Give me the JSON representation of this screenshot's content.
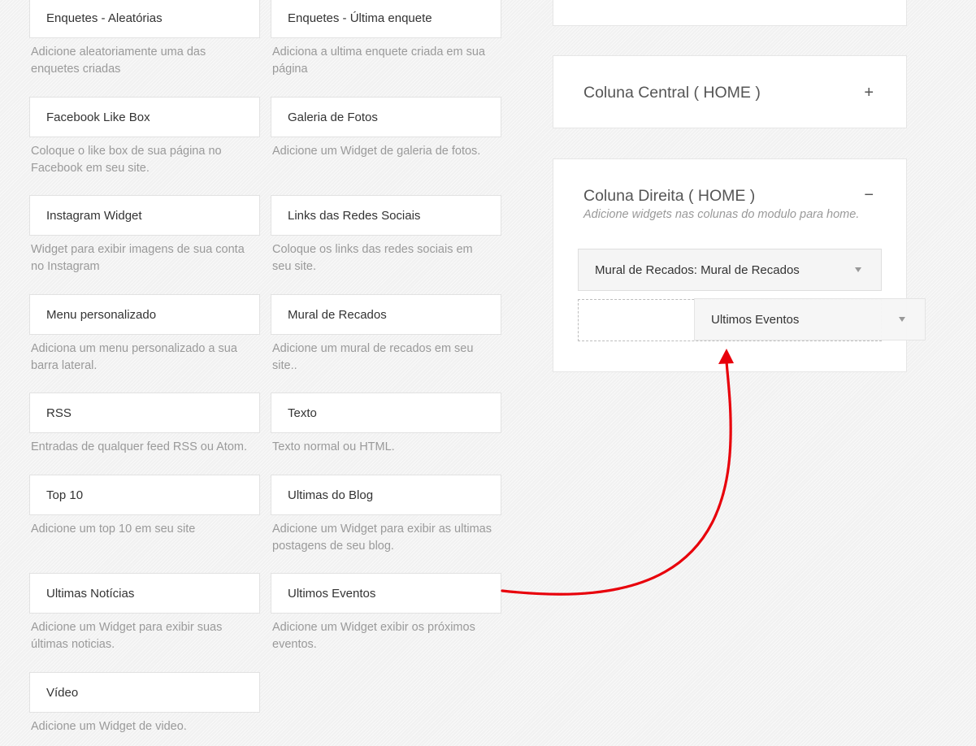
{
  "widgets": [
    {
      "title": "Enquetes - Aleatórias",
      "desc": "Adicione aleatoriamente uma das enquetes criadas"
    },
    {
      "title": "Enquetes - Última enquete",
      "desc": "Adiciona a ultima enquete criada em sua página"
    },
    {
      "title": "Facebook Like Box",
      "desc": "Coloque o like box de sua página no Facebook em seu site."
    },
    {
      "title": "Galeria de Fotos",
      "desc": "Adicione um Widget de galeria de fotos."
    },
    {
      "title": "Instagram Widget",
      "desc": "Widget para exibir imagens de sua conta no Instagram"
    },
    {
      "title": "Links das Redes Sociais",
      "desc": "Coloque os links das redes sociais em seu site."
    },
    {
      "title": "Menu personalizado",
      "desc": "Adiciona um menu personalizado a sua barra lateral."
    },
    {
      "title": "Mural de Recados",
      "desc": "Adicione um mural de recados em seu site.."
    },
    {
      "title": "RSS",
      "desc": "Entradas de qualquer feed RSS ou Atom."
    },
    {
      "title": "Texto",
      "desc": "Texto normal ou HTML."
    },
    {
      "title": "Top 10",
      "desc": "Adicione um top 10 em seu site"
    },
    {
      "title": "Ultimas do Blog",
      "desc": "Adicione um Widget para exibir as ultimas postagens de seu blog."
    },
    {
      "title": "Ultimas Notícias",
      "desc": "Adicione um Widget para exibir suas últimas noticias."
    },
    {
      "title": "Ultimos Eventos",
      "desc": "Adicione um Widget exibir os próximos eventos."
    },
    {
      "title": "Vídeo",
      "desc": "Adicione um Widget de video."
    }
  ],
  "panels": {
    "central": {
      "title": "Coluna Central ( HOME )",
      "toggle": "+"
    },
    "direita": {
      "title": "Coluna Direita ( HOME )",
      "toggle": "−",
      "subtitle": "Adicione widgets nas colunas do modulo para home.",
      "placed_widget": "Mural de Recados: Mural de Recados",
      "dragging_widget": "Ultimos Eventos"
    }
  },
  "colors": {
    "arrow": "#e8000b"
  }
}
